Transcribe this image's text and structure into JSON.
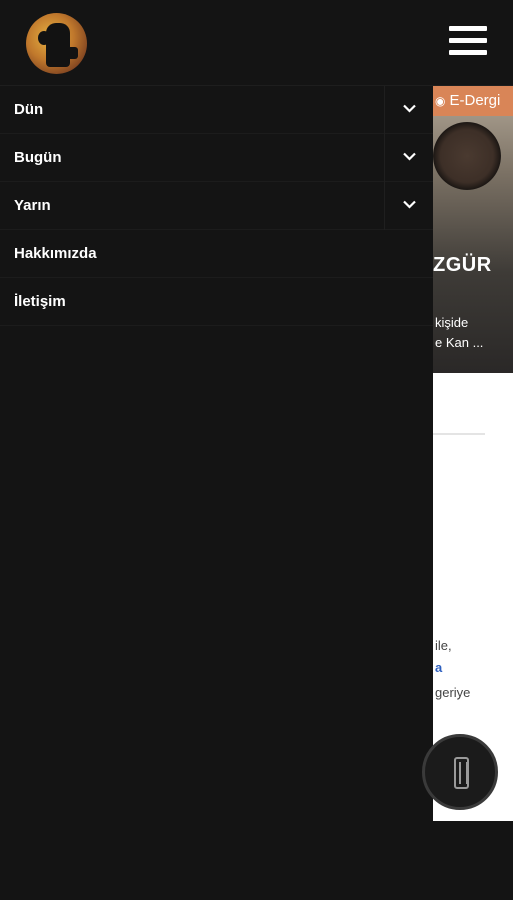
{
  "header": {
    "logo_icon": "site-logo-icon",
    "menu_icon": "hamburger-menu-icon"
  },
  "menu": {
    "items": [
      {
        "label": "Dün",
        "expandable": true
      },
      {
        "label": "Bugün",
        "expandable": true
      },
      {
        "label": "Yarın",
        "expandable": true
      },
      {
        "label": "Hakkımızda",
        "expandable": false
      },
      {
        "label": "İletişim",
        "expandable": false
      }
    ]
  },
  "background_page": {
    "badge": "E-Dergi",
    "hero_title": "ZGÜR",
    "hero_sub1": "kişide",
    "hero_sub2": "e Kan ...",
    "text1": "ile,",
    "text2": "a",
    "text3": "geriye"
  },
  "fab": {
    "icon": "ashtray-icon"
  },
  "colors": {
    "background": "#141414",
    "badge": "#d98557",
    "link": "#2d5fbf"
  }
}
